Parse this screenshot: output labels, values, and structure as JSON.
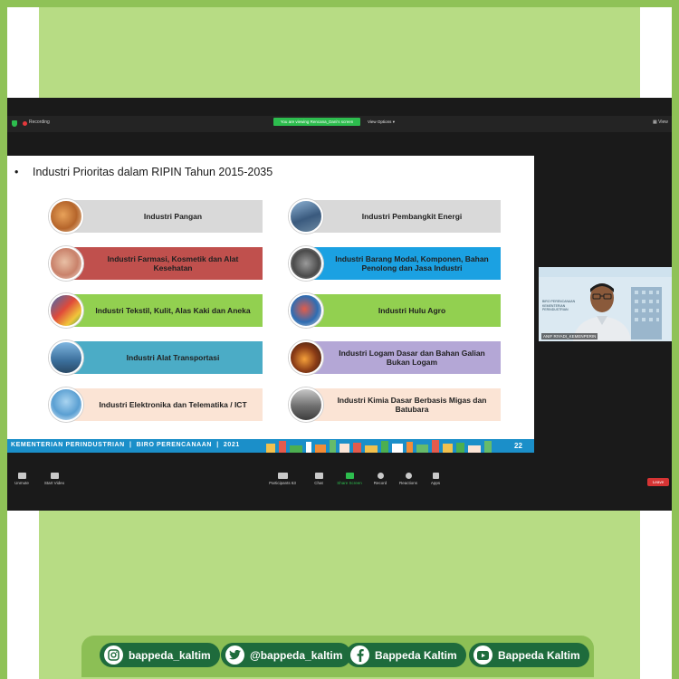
{
  "zoom": {
    "recording_label": "Recording",
    "viewing_banner": "You are viewing Rencana_Dani's screen",
    "view_options_label": "View Options",
    "view_label": "View",
    "toolbar": {
      "unmute": "Unmute",
      "start_video": "Start Video",
      "participants": "Participants",
      "participants_count": "63",
      "chat": "Chat",
      "share_screen": "Share Screen",
      "record": "Record",
      "reactions": "Reactions",
      "apps": "Apps",
      "leave": "Leave"
    },
    "participant_tile": {
      "caption_line1": "BIRO PERENCANAAN",
      "caption_line2": "KEMENTERIAN PERINDUSTRIAN",
      "name_label": "ANIF RIYADI_KEMENPERIN"
    }
  },
  "slide": {
    "bullet": "•",
    "title": "Industri Prioritas dalam RIPIN Tahun 2015-2035",
    "left_items": [
      {
        "label": "Industri Pangan",
        "color": "#d9d9d9"
      },
      {
        "label": "Industri Farmasi, Kosmetik dan Alat Kesehatan",
        "color": "#c0504d"
      },
      {
        "label": "Industri Tekstil,  Kulit, Alas Kaki dan Aneka",
        "color": "#92d050"
      },
      {
        "label": "Industri Alat Transportasi",
        "color": "#4bacc6"
      },
      {
        "label": "Industri Elektronika dan Telematika / ICT",
        "color": "#fbe4d5"
      }
    ],
    "right_items": [
      {
        "label": "Industri Pembangkit Energi",
        "color": "#d9d9d9"
      },
      {
        "label": "Industri Barang Modal, Komponen, Bahan Penolong dan Jasa Industri",
        "color": "#1ba1e2"
      },
      {
        "label": "Industri Hulu Agro",
        "color": "#92d050"
      },
      {
        "label": "Industri Logam Dasar dan Bahan Galian Bukan Logam",
        "color": "#b4a7d6"
      },
      {
        "label": "Industri Kimia Dasar Berbasis Migas dan Batubara",
        "color": "#fbe4d5"
      }
    ],
    "footer": {
      "org": "KEMENTERIAN PERINDUSTRIAN",
      "separator": "|",
      "unit": "BIRO PERENCANAAN",
      "year": "2021",
      "page": "22"
    }
  },
  "social": {
    "instagram": "bappeda_kaltim",
    "twitter": "@bappeda_kaltim",
    "facebook": "Bappeda Kaltim",
    "youtube": "Bappeda Kaltim"
  },
  "colors": {
    "outer_green": "#8fc257",
    "inner_green": "#b7dc84",
    "pill_green": "#1e6b3c",
    "zoom_bg": "#1a1a1a",
    "zoom_accent": "#2dbd4e",
    "footer_blue": "#1b8fc9"
  }
}
